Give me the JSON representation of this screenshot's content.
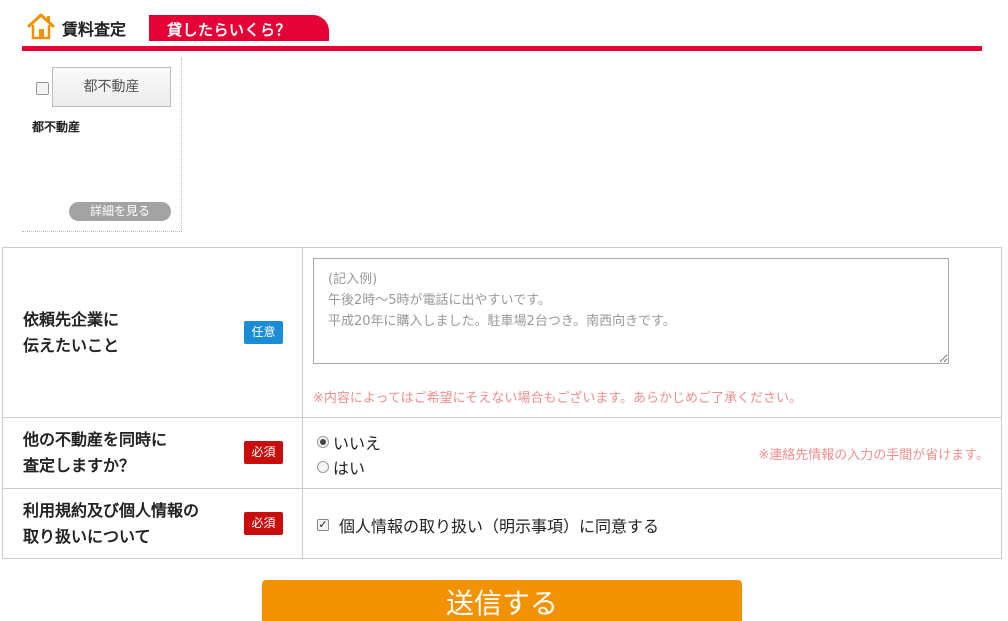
{
  "header": {
    "title": "賃料査定",
    "tag": "貸したらいくら？",
    "icon": "house-icon",
    "accent_color": "#e50036"
  },
  "property_card": {
    "checked": false,
    "thumbnail_text": "都不動産",
    "name": "都不動産",
    "detail_button": "詳細を見る"
  },
  "form": {
    "message": {
      "label": "依頼先企業に\n伝えたいこと",
      "badge": "任意",
      "placeholder": "(記入例)\n午後2時～5時が電話に出やすいです。\n平成20年に購入しました。駐車場2台つき。南西向きです。",
      "value": "",
      "note": "※内容によってはご希望にそえない場合もございます。あらかじめご了承ください。"
    },
    "other_properties": {
      "label": "他の不動産を同時に\n査定しますか？",
      "badge": "必須",
      "options": [
        {
          "label": "いいえ",
          "selected": true
        },
        {
          "label": "はい",
          "selected": false
        }
      ],
      "note": "※連絡先情報の入力の手間が省けます。"
    },
    "privacy": {
      "label": "利用規約及び個人情報の\n取り扱いについて",
      "badge": "必須",
      "checkbox_label": "個人情報の取り扱い（明示事項）に同意する",
      "checked": true
    }
  },
  "submit": {
    "label": "送信する",
    "color": "#f39200"
  }
}
